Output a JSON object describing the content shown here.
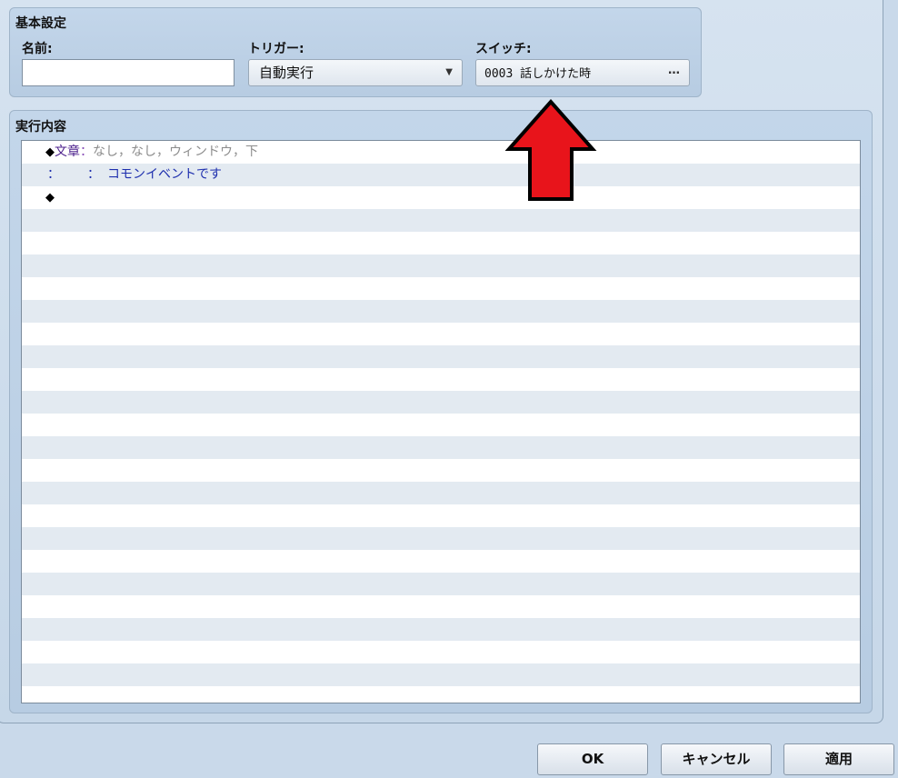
{
  "basic_settings": {
    "title": "基本設定",
    "name_label": "名前:",
    "name_value": "",
    "trigger_label": "トリガー:",
    "trigger_value": "自動実行",
    "switch_label": "スイッチ:",
    "switch_value": "0003 話しかけた時",
    "switch_more": "…"
  },
  "execution": {
    "title": "実行内容",
    "commands": [
      {
        "diamond": "◆",
        "name": "文章",
        "sep": "：",
        "args": "なし，なし，ウィンドウ，下"
      },
      {
        "colon": "：",
        "sep": "：",
        "text": "コモンイベントです"
      },
      {
        "diamond": "◆"
      }
    ],
    "row_colors": {
      "even": "#ffffff",
      "odd": "#e3eaf1"
    }
  },
  "buttons": {
    "ok": "OK",
    "cancel": "キャンセル",
    "apply": "適用"
  },
  "annotation": {
    "arrow_color": "#e8141b",
    "arrow_icon": "up-arrow-icon"
  }
}
